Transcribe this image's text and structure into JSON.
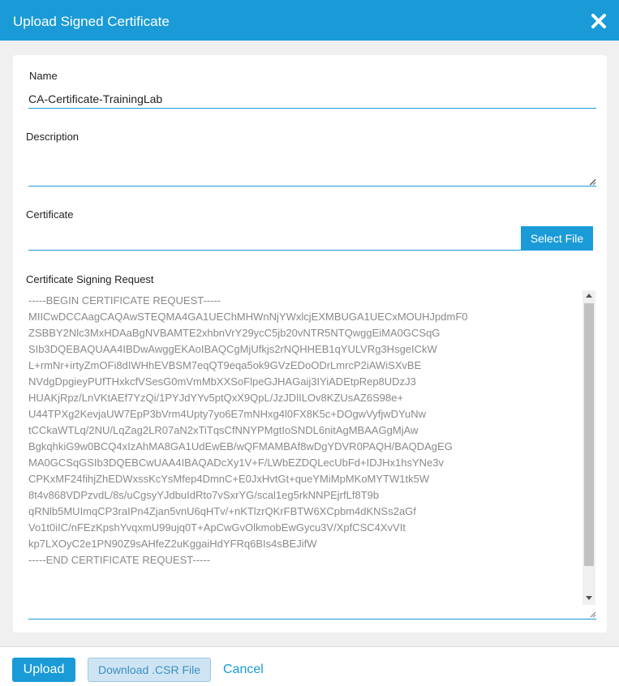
{
  "dialog": {
    "title": "Upload Signed Certificate",
    "close_icon": "close-x-icon"
  },
  "form": {
    "name_label": "Name",
    "name_value": "CA-Certificate-TrainingLab",
    "description_label": "Description",
    "description_value": "",
    "certificate_label": "Certificate",
    "select_file_label": "Select File",
    "csr_label": "Certificate Signing Request",
    "csr_lines": [
      "-----BEGIN CERTIFICATE REQUEST-----",
      "MIICwDCCAagCAQAwSTEQMA4GA1UEChMHWnNjYWxlcjEXMBUGA1UECxMOUHJpdmF0",
      "ZSBBY2Nlc3MxHDAaBgNVBAMTE2xhbnVrY29ycC5jb20vNTR5NTQwggEiMA0GCSqG",
      "SIb3DQEBAQUAA4IBDwAwggEKAoIBAQCgMjUfkjs2rNQHHEB1qYULVRg3HsgeICkW",
      "L+rmNr+irtyZmOFi8dIWHhEVBSM7eqQT9eqa5ok9GVzEDoODrLmrcP2iAWiSXvBE",
      "NVdgDpgieyPUfTHxkcfVSesG0mVmMbXXSoFlpeGJHAGaij3IYiADEtpRep8UDzJ3",
      "HUAKjRpz/LnVKtAEf7YzQi/1PYJdYYv5ptQxX9QpL/JzJDlILOv8KZUsAZ6S98e+",
      "U44TPXg2KevjaUW7EpP3bVrm4Upty7yo6E7mNHxg4l0FX8K5c+DOgwVyfjwDYuNw",
      "tCCkaWTLq/2NU/LqZag2LR07aN2xTiTqsCfNNYPMgtIoSNDL6nitAgMBAAGgMjAw",
      "BgkqhkiG9w0BCQ4xIzAhMA8GA1UdEwEB/wQFMAMBAf8wDgYDVR0PAQH/BAQDAgEG",
      "MA0GCSqGSIb3DQEBCwUAA4IBAQADcXy1V+F/LWbEZDQLecUbFd+IDJHx1hsYNe3v",
      "CPKxMF24fihjZhEDWxssKcYsMfep4DmnC+E0JxHvtGt+queYMiMpMKoMYTW1tk5W",
      "8t4v868VDPzvdL/8s/uCgsyYJdbuIdRto7vSxrYG/scal1eg5rkNNPEjrfLf8T9b",
      "qRNlb5MUImqCP3raIPn4Zjan5vnU6qHTv/+nKTlzrQKrFBTW6XCpbm4dKNSs2aGf",
      "Vo1t0iIC/nFEzKpshYvqxmU99ujq0T+ApCwGvOlkmobEwGycu3V/XpfCSC4XvVIt",
      "kp7LXOyC2e1PN90Z9sAHfeZ2uKggaiHdYFRq6BIs4sBEJifW",
      "-----END CERTIFICATE REQUEST-----"
    ]
  },
  "footer": {
    "upload_label": "Upload",
    "download_label": "Download .CSR File",
    "cancel_label": "Cancel"
  },
  "colors": {
    "accent": "#1a9bd7",
    "panel_bg": "#f0f0f0",
    "csr_text": "#8a8a8a"
  }
}
